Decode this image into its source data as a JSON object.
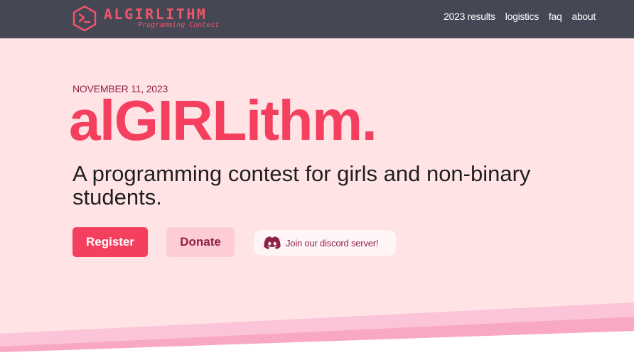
{
  "brand": {
    "wordmark": "ALGIRLITHM",
    "tagline": "Programming Contest",
    "icon": "terminal-hexagon-logo"
  },
  "nav": {
    "links": [
      {
        "label": "2023 results"
      },
      {
        "label": "logistics"
      },
      {
        "label": "faq"
      },
      {
        "label": "about"
      }
    ]
  },
  "hero": {
    "date": "NOVEMBER 11, 2023",
    "title": "alGIRLithm.",
    "subtitle": "A programming contest for girls and non-binary students."
  },
  "actions": {
    "register_label": "Register",
    "donate_label": "Donate",
    "discord_label": "Join our discord server!",
    "discord_icon": "discord-icon"
  },
  "colors": {
    "nav_bg": "#454754",
    "hero_bg": "#ffe3e5",
    "accent": "#f43f5e",
    "dark_accent": "#8e2149",
    "secondary_bg": "#fecdd3"
  }
}
